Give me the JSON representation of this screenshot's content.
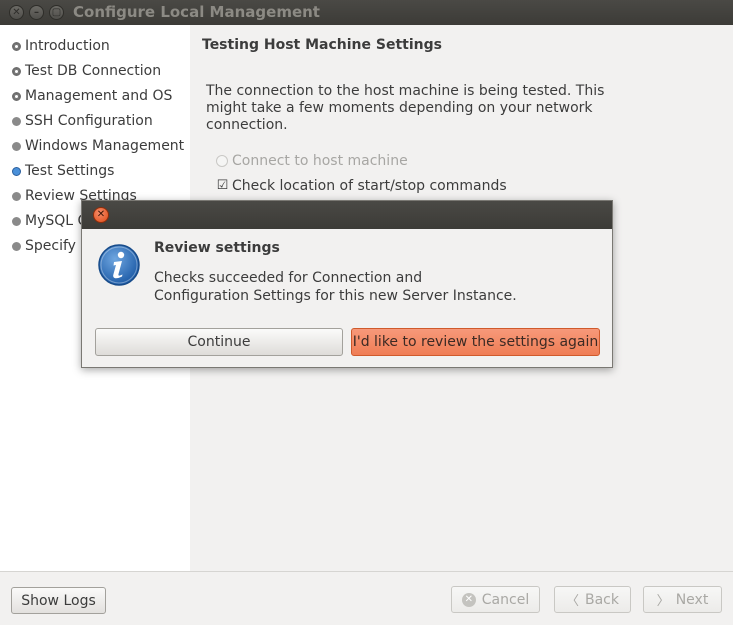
{
  "window": {
    "title": "Configure Local Management"
  },
  "sidebar": {
    "steps": [
      {
        "label": "Introduction",
        "state": "done"
      },
      {
        "label": "Test DB Connection",
        "state": "done"
      },
      {
        "label": "Management and OS",
        "state": "done"
      },
      {
        "label": "SSH Configuration",
        "state": "pending"
      },
      {
        "label": "Windows Management",
        "state": "pending"
      },
      {
        "label": "Test Settings",
        "state": "current"
      },
      {
        "label": "Review Settings",
        "state": "pending"
      },
      {
        "label": "MySQL C",
        "state": "pending"
      },
      {
        "label": "Specify C",
        "state": "pending"
      }
    ]
  },
  "main": {
    "heading": "Testing Host Machine Settings",
    "description": "The connection to the host machine is being tested. This might take a few moments depending on your network connection.",
    "tasks": [
      {
        "label": "Connect to host machine",
        "state": "disabled"
      },
      {
        "label": "Check location of start/stop commands",
        "state": "checked"
      }
    ]
  },
  "dialog": {
    "heading": "Review settings",
    "message_line1": "Checks succeeded for Connection and",
    "message_line2": "Configuration Settings for this new Server Instance.",
    "continue_label": "Continue",
    "review_label": "I'd like to review the settings again"
  },
  "bottom": {
    "show_logs_label": "Show Logs",
    "cancel_label": "Cancel",
    "back_label": "Back",
    "next_label": "Next"
  },
  "colors": {
    "titlebar": "#3c3b37",
    "accent_orange": "#ef7d55",
    "current_step_dot": "#4a90d9",
    "sidebar_bg": "#ffffff",
    "window_bg": "#f2f1f0"
  },
  "icons": {
    "window_close": "close-icon",
    "window_minimize": "minimize-icon",
    "window_maximize": "maximize-icon",
    "dialog_info": "info-icon",
    "dialog_close": "close-icon",
    "task_check": "checkmark-icon",
    "cancel": "cancel-icon",
    "back": "chevron-left-icon",
    "next": "chevron-right-icon"
  }
}
